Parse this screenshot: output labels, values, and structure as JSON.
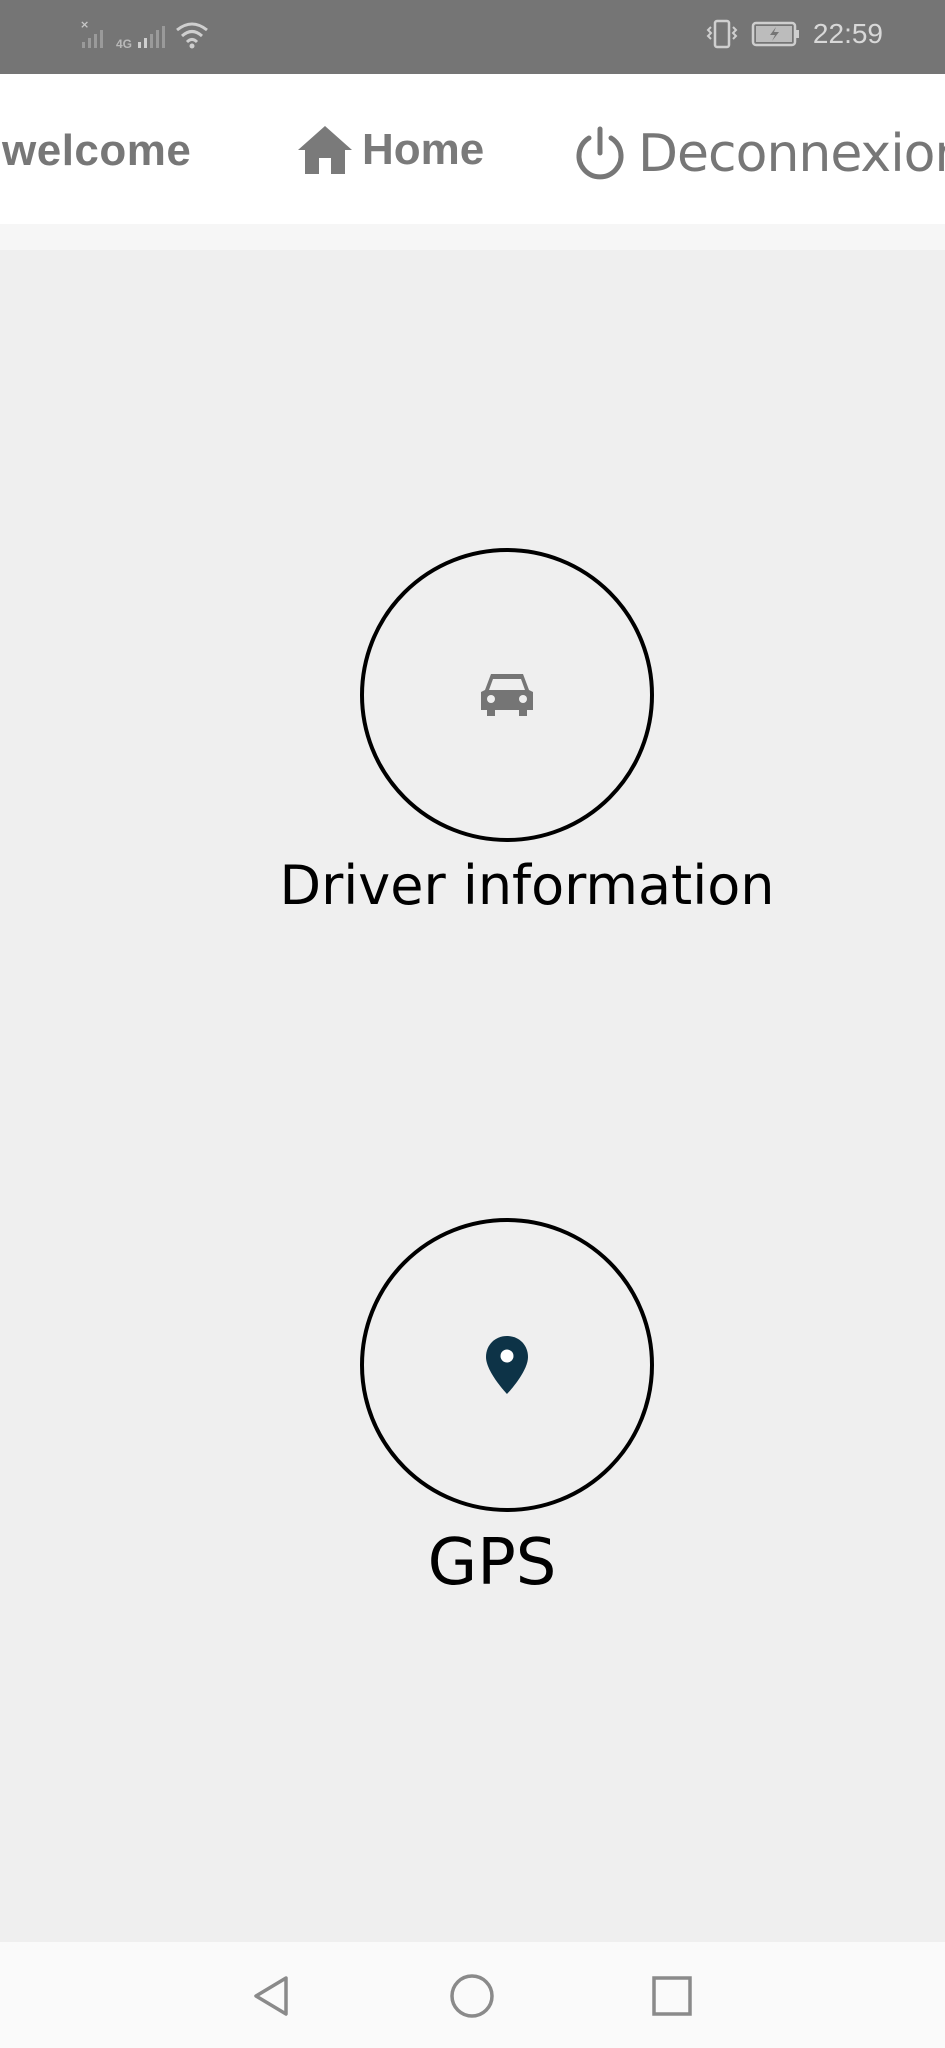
{
  "status_bar": {
    "network_type": "4G",
    "time": "22:59"
  },
  "navbar": {
    "welcome_label": "welcome",
    "home_label": "Home",
    "logout_label": "Deconnexion"
  },
  "tiles": [
    {
      "label": "Driver information",
      "icon": "car-icon"
    },
    {
      "label": "GPS",
      "icon": "map-pin-icon"
    }
  ],
  "colors": {
    "status_bar": "#757575",
    "background": "#efefef",
    "nav_text": "#777777",
    "pin": "#0d3347",
    "car": "#757575"
  },
  "system_nav": [
    "back-icon",
    "home-circle-icon",
    "recents-icon"
  ]
}
